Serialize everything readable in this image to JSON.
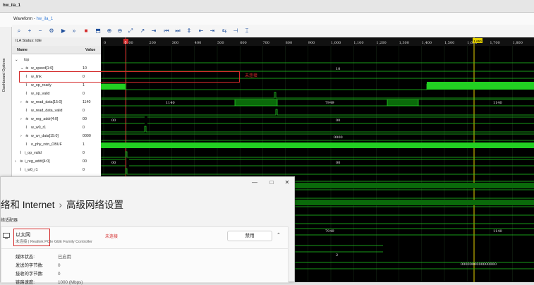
{
  "window": {
    "title": "hw_ila_1"
  },
  "waveform_header": {
    "label": "Waveform -",
    "name": "hw_ila_1"
  },
  "dashboard": {
    "label": "Dashboard Options"
  },
  "ila": {
    "status": "ILA Status: Idle"
  },
  "columns": {
    "name": "Name",
    "value": "Value"
  },
  "signals": [
    {
      "name": "top",
      "value": ""
    },
    {
      "name": "w_speed[1:0]",
      "value": "10"
    },
    {
      "name": "w_link",
      "value": "0"
    },
    {
      "name": "w_op_ready",
      "value": "1"
    },
    {
      "name": "w_op_valid",
      "value": "0"
    },
    {
      "name": "w_read_data[15:0]",
      "value": "1140"
    },
    {
      "name": "w_read_data_valid",
      "value": "0"
    },
    {
      "name": "w_reg_addr[4:0]",
      "value": "00"
    },
    {
      "name": "w_w0_r1",
      "value": "0"
    },
    {
      "name": "w_wr_data[15:0]",
      "value": "0000"
    },
    {
      "name": "o_phy_rstn_OBUF",
      "value": "1"
    },
    {
      "name": "i_op_valid",
      "value": "0"
    },
    {
      "name": "i_reg_addr[4:0]",
      "value": "00"
    },
    {
      "name": "i_w0_r1",
      "value": "0"
    }
  ],
  "timeline": {
    "ticks": [
      "0",
      "100",
      "200",
      "300",
      "400",
      "500",
      "600",
      "700",
      "800",
      "900",
      "1,000",
      "1,100",
      "1,200",
      "1,300",
      "1,400",
      "1,500",
      "1,600",
      "1,700",
      "1,800"
    ],
    "marker_left": "0",
    "marker_right": "1,650"
  },
  "wave_labels": {
    "speed": "10",
    "read_data_a": "1140",
    "read_data_b": "7949",
    "read_data_c": "1140",
    "reg_addr_a": "00",
    "reg_addr_b": "00",
    "wr_data": "0000",
    "i_reg_addr_a": "00",
    "i_reg_addr_b": "00",
    "lower_a": "7949",
    "lower_b": "2",
    "lower_c": "0000000000000000",
    "lower_d": "1140"
  },
  "annotations": {
    "link_note": "未连接",
    "eth_note": "未连接"
  },
  "dialog": {
    "breadcrumb_parent": "络和 Internet",
    "breadcrumb_sep": "›",
    "breadcrumb_current": "高级网络设置",
    "section": "络适配器",
    "adapter_name": "以太网",
    "adapter_desc": "未连接 | Realtek PCIe GbE Family Controller",
    "disable_button": "禁用",
    "details": [
      {
        "k": "媒体状态:",
        "v": "已启用"
      },
      {
        "k": "发送的字节数:",
        "v": "0"
      },
      {
        "k": "接收的字节数:",
        "v": "0"
      },
      {
        "k": "链路速度:",
        "v": "1000 (Mbps)"
      }
    ]
  },
  "colors": {
    "wave": "#22d022",
    "cursor_red": "#d42a2a",
    "cursor_yellow": "#e6d200",
    "bg": "#000000"
  }
}
